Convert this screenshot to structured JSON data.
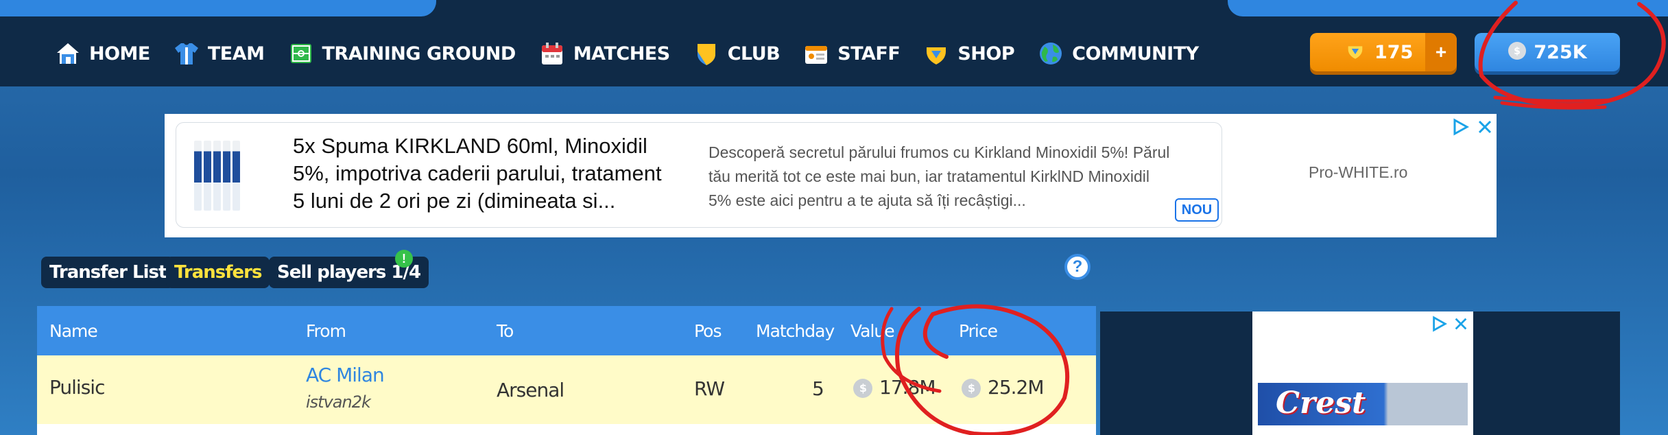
{
  "nav": {
    "items": [
      {
        "label": "HOME",
        "icon": "home-icon"
      },
      {
        "label": "TEAM",
        "icon": "jersey-icon"
      },
      {
        "label": "TRAINING GROUND",
        "icon": "pitch-icon"
      },
      {
        "label": "MATCHES",
        "icon": "calendar-icon"
      },
      {
        "label": "CLUB",
        "icon": "shield-icon"
      },
      {
        "label": "STAFF",
        "icon": "id-card-icon"
      },
      {
        "label": "SHOP",
        "icon": "gem-icon"
      },
      {
        "label": "COMMUNITY",
        "icon": "globe-icon"
      }
    ],
    "gems": "175",
    "plus": "+",
    "coins": "725K"
  },
  "ad": {
    "title": "5x Spuma KIRKLAND 60ml, Minoxidil 5%, impotriva caderii parului, tratament 5 luni de 2 ori pe zi (dimineata si...",
    "description": "Descoperă secretul părului frumos cu Kirkland Minoxidil 5%! Părul tău merită tot ce este mai bun, iar tratamentul KirklND Minoxidil 5% este aici pentru a te ajuta să îți recâștigi...",
    "badge": "NOU",
    "brand": "Pro-WHITE.ro"
  },
  "tabs": {
    "transfer_list": "Transfer List",
    "transfers": "Transfers",
    "sell_players": "Sell players 1/4",
    "badge": "!",
    "help": "?"
  },
  "table": {
    "headers": {
      "name": "Name",
      "from": "From",
      "to": "To",
      "pos": "Pos",
      "matchday": "Matchday",
      "value": "Value",
      "price": "Price"
    },
    "rows": [
      {
        "name": "Pulisic",
        "from_club": "AC Milan",
        "from_user": "istvan2k",
        "to": "Arsenal",
        "pos": "RW",
        "matchday": "5",
        "value": "17.8M",
        "price": "25.2M"
      }
    ]
  },
  "sidead": {
    "brand": "Crest"
  },
  "colors": {
    "nav_bg": "#0f2a47",
    "accent_blue": "#2f86e0",
    "gem_orange": "#f08c00",
    "row_highlight": "#fffbc8",
    "active_tab": "#ffe23d",
    "annotation_red": "#e02020"
  }
}
